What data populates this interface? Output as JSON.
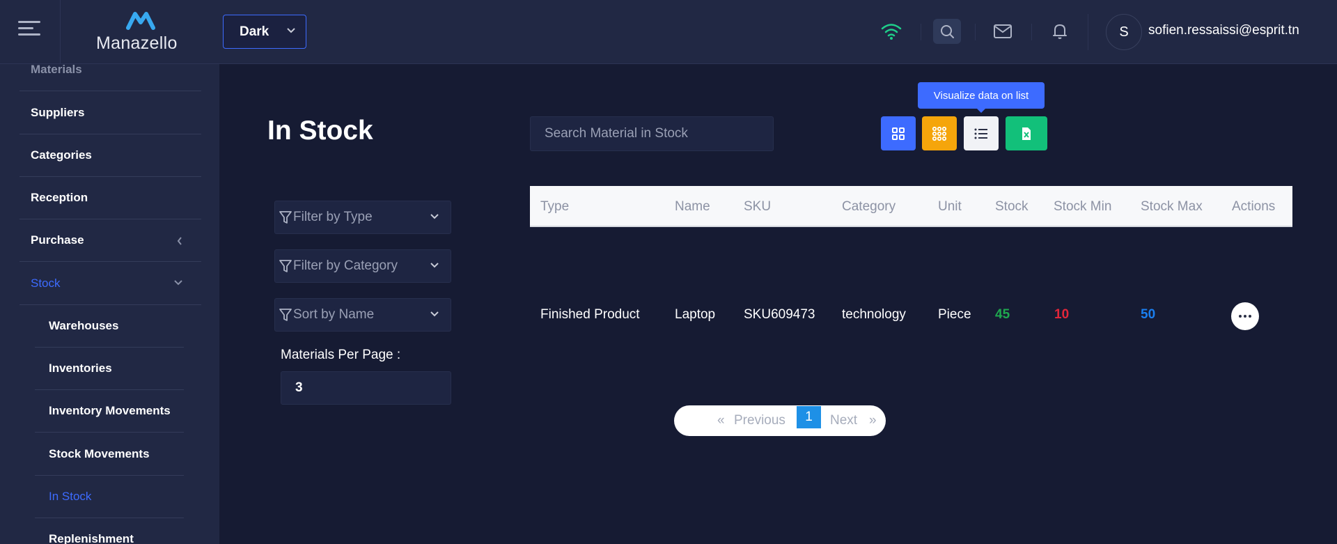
{
  "header": {
    "logo_text": "Manazello",
    "theme_value": "Dark",
    "user_initial": "S",
    "user_email": "sofien.ressaissi@esprit.tn",
    "icons": [
      "menu-icon",
      "wifi-icon",
      "search-icon",
      "mail-icon",
      "bell-icon"
    ]
  },
  "sidebar": {
    "items": [
      {
        "label": "Materials"
      },
      {
        "label": "Suppliers"
      },
      {
        "label": "Categories"
      },
      {
        "label": "Reception"
      },
      {
        "label": "Purchase"
      },
      {
        "label": "Stock"
      }
    ],
    "stock_children": [
      {
        "label": "Warehouses"
      },
      {
        "label": "Inventories"
      },
      {
        "label": "Inventory Movements"
      },
      {
        "label": "Stock Movements"
      },
      {
        "label": "In Stock"
      },
      {
        "label": "Replenishment"
      }
    ],
    "active_item": "In Stock"
  },
  "main": {
    "title": "In Stock",
    "search_placeholder": "Search Material in Stock",
    "tooltip": "Visualize data on list",
    "view_buttons": [
      {
        "name": "grid-view",
        "color": "#3d6bff"
      },
      {
        "name": "apps-view",
        "color": "#f5a50b"
      },
      {
        "name": "list-view",
        "color": "#f1f2f6"
      },
      {
        "name": "excel-export",
        "color": "#12c07a"
      }
    ],
    "filters": {
      "type": "Filter by Type",
      "category": "Filter by Category",
      "sort": "Sort by Name"
    },
    "per_page_label": "Materials Per Page :",
    "per_page_value": "3"
  },
  "table": {
    "headers": [
      "Type",
      "Name",
      "SKU",
      "Category",
      "Unit",
      "Stock",
      "Stock Min",
      "Stock Max",
      "Actions"
    ],
    "rows": [
      {
        "type": "Finished Product",
        "name": "Laptop",
        "sku": "SKU609473",
        "category": "technology",
        "unit": "Piece",
        "stock": "45",
        "stock_min": "10",
        "stock_max": "50"
      }
    ]
  },
  "pagination": {
    "prev_symbol": "«",
    "prev_label": "Previous",
    "current_page": "1",
    "next_label": "Next",
    "next_symbol": "»"
  }
}
